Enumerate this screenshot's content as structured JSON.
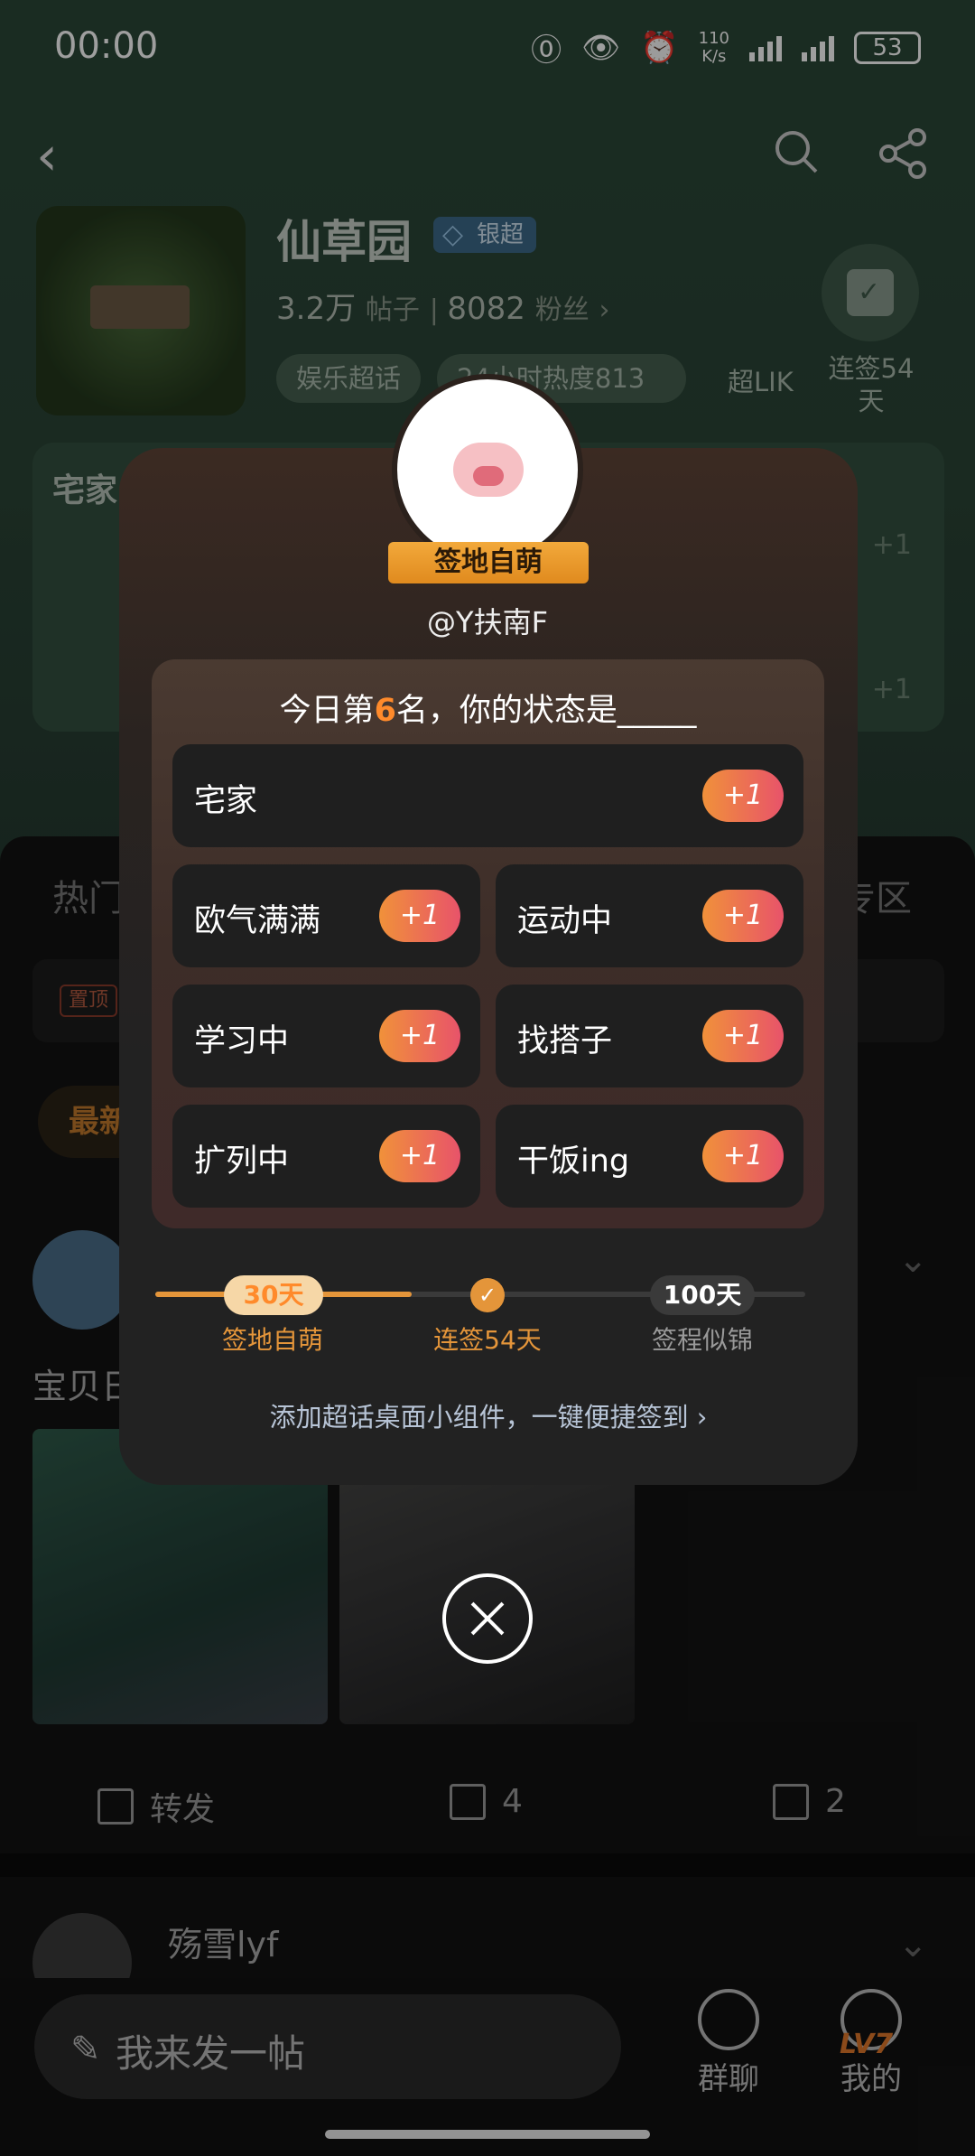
{
  "status_bar": {
    "time": "00:00",
    "net_speed_value": "110",
    "net_speed_unit": "K/s",
    "battery": "53",
    "icons": [
      "nfc-icon",
      "eye-icon",
      "alarm-icon",
      "signal-icon",
      "battery-icon"
    ]
  },
  "nav": {
    "icons": [
      "back-icon",
      "search-icon",
      "share-icon"
    ]
  },
  "supertopic": {
    "title": "仙草园",
    "badge": "银超",
    "posts_count": "3.2万",
    "posts_label": "帖子",
    "fans_count": "8082",
    "fans_label": "粉丝",
    "tag1": "娱乐超话",
    "tag2": "24小时热度813",
    "chao_label": "超LIK",
    "checkin_label": "连签54天"
  },
  "background_card": {
    "label": "宅家",
    "plus_a": "+1",
    "plus_b": "+1"
  },
  "tabs": {
    "hot": "热门",
    "zone": "专区"
  },
  "pin_label": "置顶",
  "latest_label": "最新",
  "post": {
    "text": "宝贝日",
    "repost_label": "转发",
    "comments": "4",
    "likes": "2"
  },
  "next_user": {
    "name": "殇雪lyf"
  },
  "bottom_bar": {
    "compose_placeholder": "我来发一帖",
    "chat_label": "群聊",
    "me_label": "我的",
    "level_badge": "LV7"
  },
  "popup": {
    "title_badge": "签地自萌",
    "username": "@Y扶南F",
    "question_prefix": "今日第",
    "rank": "6",
    "question_suffix": "名，你的状态是_____",
    "options": [
      {
        "label": "宅家",
        "plus": "+1"
      },
      {
        "label": "欧气满满",
        "plus": "+1"
      },
      {
        "label": "运动中",
        "plus": "+1"
      },
      {
        "label": "学习中",
        "plus": "+1"
      },
      {
        "label": "找搭子",
        "plus": "+1"
      },
      {
        "label": "扩列中",
        "plus": "+1"
      },
      {
        "label": "干饭ing",
        "plus": "+1"
      }
    ],
    "progress": {
      "fraction": 0.54,
      "m1_days": "30天",
      "m1_label": "签地自萌",
      "current_label": "连签54天",
      "m2_days": "100天",
      "m2_label": "签程似锦"
    },
    "widget_link": "添加超话桌面小组件，一键便捷签到 ›"
  },
  "colors": {
    "accent": "#ff8a2b",
    "plus_gradient_start": "#f0913a",
    "plus_gradient_end": "#e8536a",
    "header_green": "#2b4838"
  }
}
